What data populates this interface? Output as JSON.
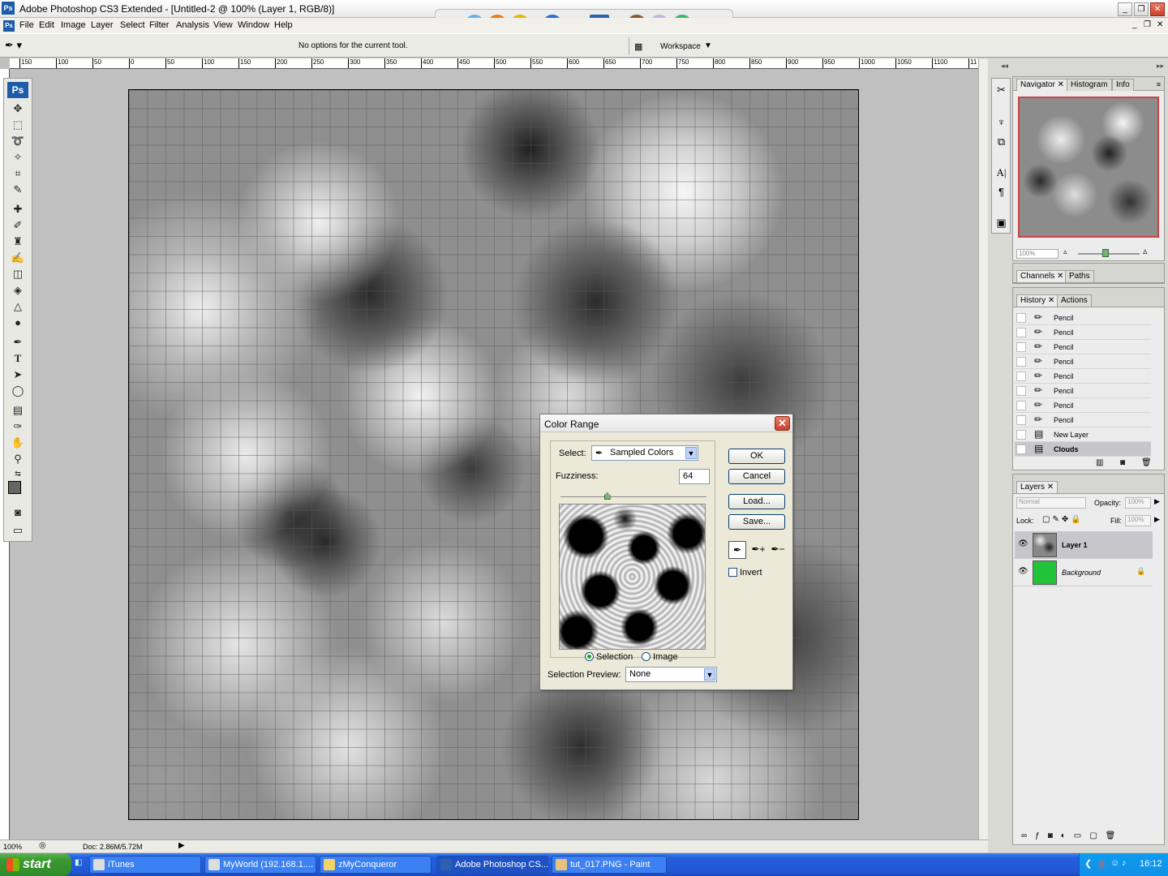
{
  "window": {
    "title": "Adobe Photoshop CS3 Extended - [Untitled-2 @ 100% (Layer 1, RGB/8)]",
    "app_badge": "Ps"
  },
  "menu": [
    "File",
    "Edit",
    "Image",
    "Layer",
    "Select",
    "Filter",
    "Analysis",
    "View",
    "Window",
    "Help"
  ],
  "options_bar": {
    "message": "No options for the current tool.",
    "workspace_label": "Workspace"
  },
  "ruler": {
    "labels": [
      "150",
      "100",
      "50",
      "0",
      "50",
      "100",
      "150",
      "200",
      "250",
      "300",
      "350",
      "400",
      "450",
      "500",
      "550",
      "600",
      "650",
      "700",
      "750",
      "800",
      "850",
      "900",
      "950",
      "1000",
      "1050",
      "1100",
      "11"
    ]
  },
  "toolbox": {
    "logo": "Ps"
  },
  "status": {
    "zoom": "100%",
    "doc": "Doc: 2.86M/5.72M"
  },
  "panels": {
    "navigator_tabs": [
      "Navigator",
      "Histogram",
      "Info"
    ],
    "nav_zoom": "100%",
    "channels_tabs": [
      "Channels",
      "Paths"
    ],
    "history_tabs": [
      "History",
      "Actions"
    ],
    "history": [
      "Pencil",
      "Pencil",
      "Pencil",
      "Pencil",
      "Pencil",
      "Pencil",
      "Pencil",
      "Pencil",
      "New Layer",
      "Clouds"
    ],
    "layers_tabs": [
      "Layers"
    ],
    "blend_mode": "Normal",
    "opacity_label": "Opacity:",
    "opacity": "100%",
    "lock_label": "Lock:",
    "fill_label": "Fill:",
    "fill": "100%",
    "layers": [
      "Layer 1",
      "Background"
    ]
  },
  "dialog": {
    "title": "Color Range",
    "select_label": "Select:",
    "select_value": "Sampled Colors",
    "fuzziness_label": "Fuzziness:",
    "fuzziness_value": "64",
    "fuzziness_level": 0.32,
    "ok": "OK",
    "cancel": "Cancel",
    "load": "Load...",
    "save": "Save...",
    "invert": "Invert",
    "radio_selection": "Selection",
    "radio_image": "Image",
    "preview_label": "Selection Preview:",
    "preview_value": "None"
  },
  "taskbar": {
    "start": "start",
    "tasks": [
      "iTunes",
      "MyWorld (192.168.1....",
      "zMyConqueror",
      "Adobe Photoshop CS...",
      "tut_017.PNG - Paint"
    ],
    "clock": "16:12"
  },
  "colors": {
    "accent": "#245edb",
    "swatch_bg_green": "#22c23a"
  }
}
